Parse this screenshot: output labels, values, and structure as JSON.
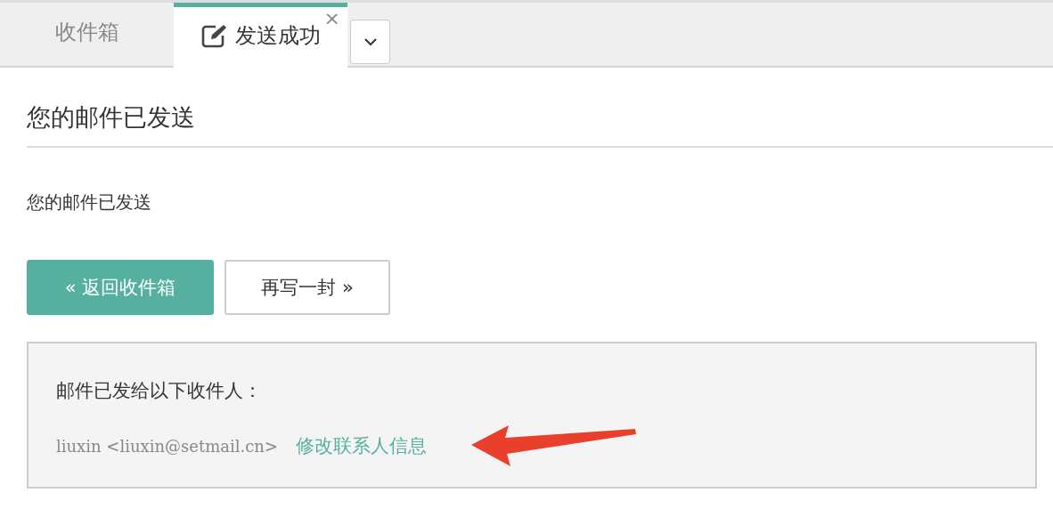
{
  "tabs": [
    {
      "label": "收件箱",
      "selected": false,
      "icon": false,
      "closable": false
    },
    {
      "label": "发送成功",
      "selected": true,
      "icon": true,
      "closable": true
    }
  ],
  "tab_close": "×",
  "page_title": "您的邮件已发送",
  "message": "您的邮件已发送",
  "buttons": [
    {
      "label": "« 返回收件箱",
      "kind": "primary"
    },
    {
      "label": "再写一封 »",
      "kind": "outline"
    }
  ],
  "recipients_panel": {
    "heading": "邮件已发给以下收件人：",
    "recipients": [
      {
        "address": "liuxin <liuxin@setmail.cn>",
        "link": "修改联系人信息"
      }
    ]
  }
}
